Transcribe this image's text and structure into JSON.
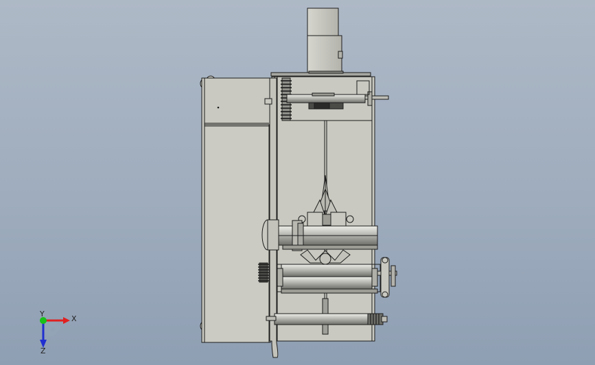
{
  "viewport": {
    "background_top": "#aeb9c6",
    "background_bottom": "#8f9fb3",
    "part_fill": "#c9c9c1",
    "part_fill_dark": "#9d9d96",
    "line_color": "#1c1c1c"
  },
  "triad": {
    "x_label": "X",
    "y_label": "Y",
    "z_label": "Z",
    "x_color": "#e02020",
    "y_color": "#18c018",
    "z_color": "#2030d0"
  }
}
